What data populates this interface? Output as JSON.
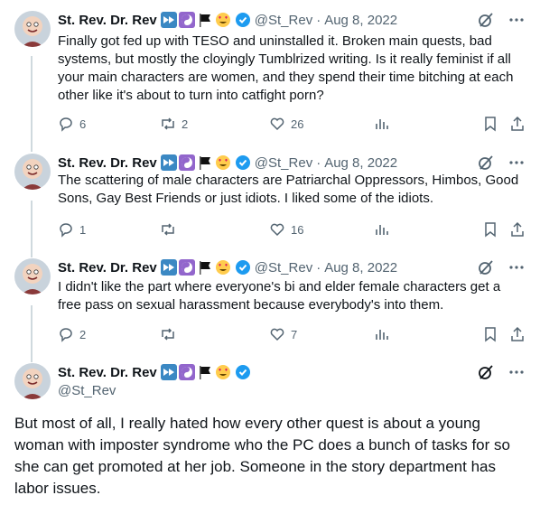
{
  "author": {
    "name": "St. Rev. Dr. Rev",
    "handle": "@St_Rev"
  },
  "tweets": [
    {
      "date": "Aug 8, 2022",
      "text": "Finally got fed up with TESO and uninstalled it. Broken main quests, bad systems, but mostly the cloyingly Tumblrized writing. Is it really feminist if all your main characters are women, and they spend their time bitching at each other like it's about to turn into catfight porn?",
      "replies": "6",
      "retweets": "2",
      "likes": "26"
    },
    {
      "date": "Aug 8, 2022",
      "text": "The scattering of male characters are Patriarchal Oppressors, Himbos, Good Sons, Gay Best Friends or just idiots. I liked some of the idiots.",
      "replies": "1",
      "retweets": "",
      "likes": "16"
    },
    {
      "date": "Aug 8, 2022",
      "text": "I didn't like the part where everyone's bi and elder female characters get a free pass on sexual harassment because everybody's into them.",
      "replies": "2",
      "retweets": "",
      "likes": "7"
    }
  ],
  "main_tweet": {
    "text": "But most of all, I really hated how every other quest is about a young woman with imposter syndrome who the PC does a bunch of tasks for so she can get promoted at her job. Someone in the story department has labor issues."
  },
  "separator": "·",
  "colors": {
    "text": "#0f1419",
    "secondary": "#536471",
    "verified": "#1d9bf0",
    "thread_line": "#cfd9de"
  },
  "icons": {
    "reply": "reply-icon",
    "retweet": "retweet-icon",
    "like": "heart-icon",
    "views": "views-icon",
    "bookmark": "bookmark-icon",
    "share": "share-icon",
    "grok": "grok-icon",
    "more": "more-icon",
    "verified": "verified-badge-icon"
  }
}
